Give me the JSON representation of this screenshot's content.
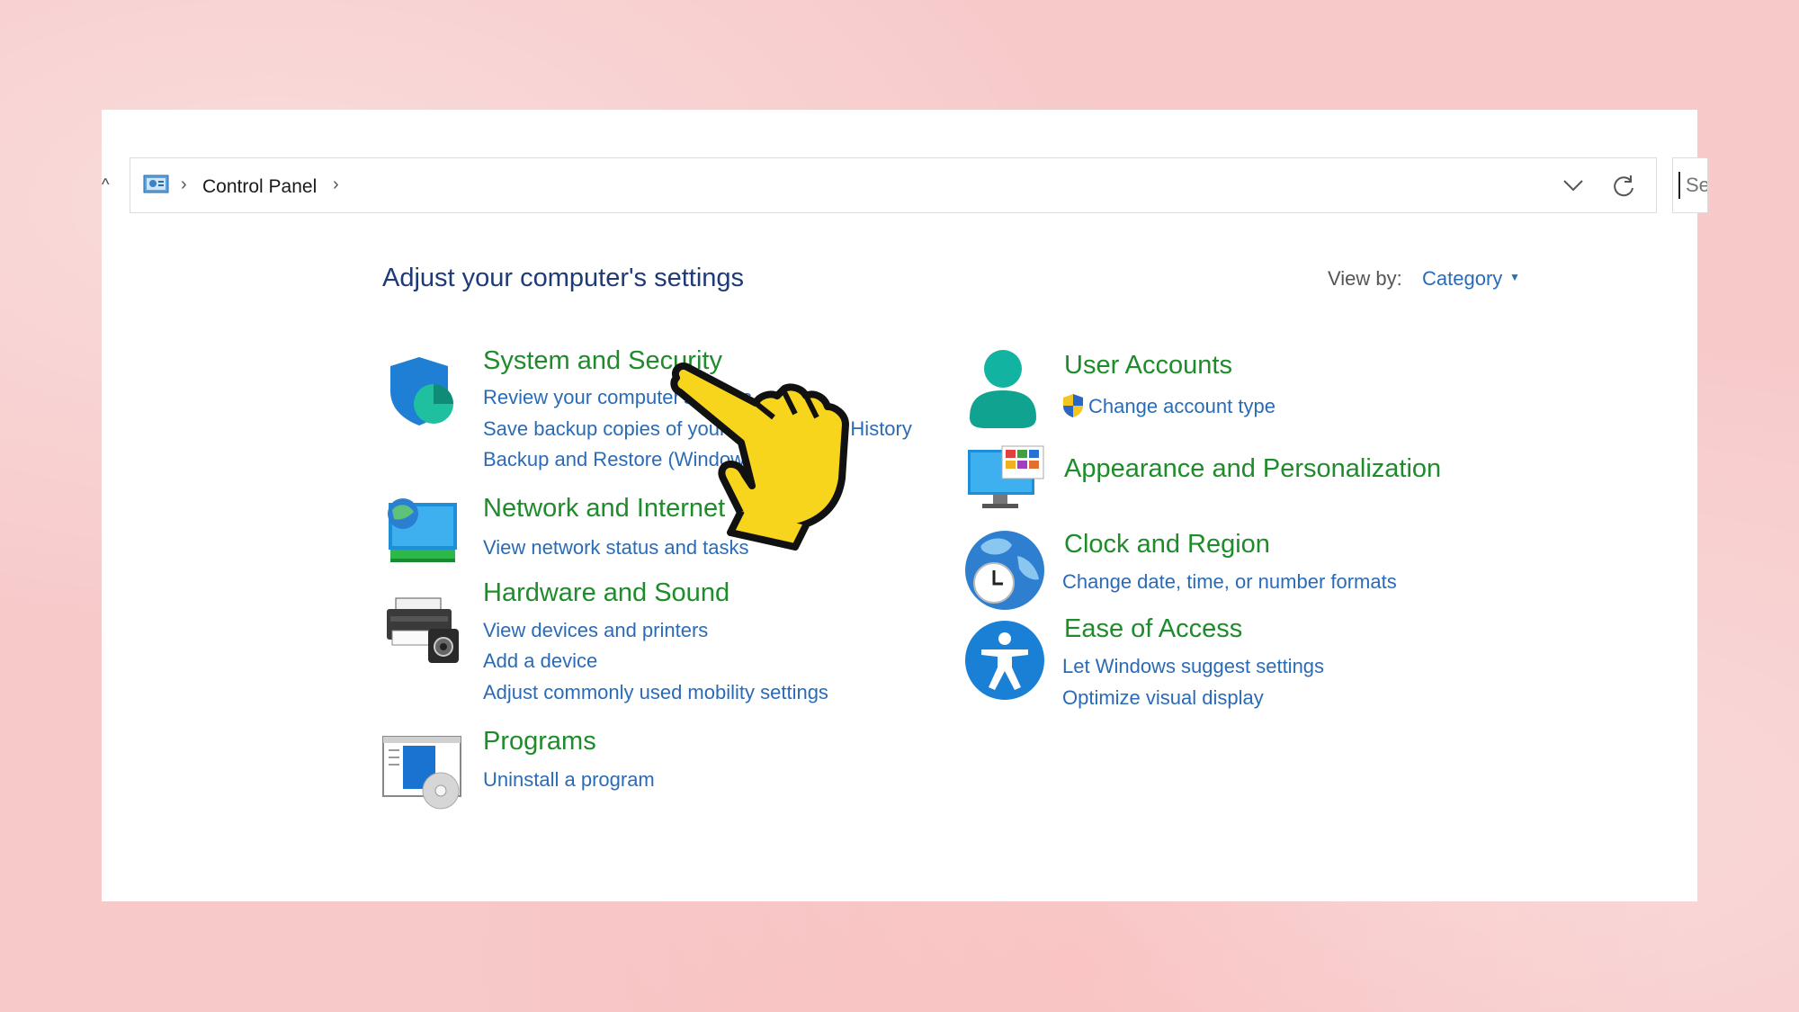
{
  "address_bar": {
    "breadcrumb": "Control Panel",
    "separator": "›"
  },
  "search": {
    "placeholder": "Se"
  },
  "header": {
    "title": "Adjust your computer's settings",
    "view_by_label": "View by:",
    "view_by_value": "Category"
  },
  "categories": [
    {
      "icon": "shield-icon",
      "title": "System and Security",
      "links": [
        "Review your computer's status",
        "Save backup copies of your files with File History",
        "Backup and Restore (Windows 7)"
      ]
    },
    {
      "icon": "network-monitor-icon",
      "title": "Network and Internet",
      "links": [
        "View network status and tasks"
      ]
    },
    {
      "icon": "printer-icon",
      "title": "Hardware and Sound",
      "links": [
        "View devices and printers",
        "Add a device",
        "Adjust commonly used mobility settings"
      ]
    },
    {
      "icon": "programs-icon",
      "title": "Programs",
      "links": [
        "Uninstall a program"
      ]
    },
    {
      "icon": "user-icon",
      "title": "User Accounts",
      "links": [
        "Change account type"
      ]
    },
    {
      "icon": "appearance-monitor-icon",
      "title": "Appearance and Personalization",
      "links": []
    },
    {
      "icon": "clock-globe-icon",
      "title": "Clock and Region",
      "links": [
        "Change date, time, or number formats"
      ]
    },
    {
      "icon": "accessibility-icon",
      "title": "Ease of Access",
      "links": [
        "Let Windows suggest settings",
        "Optimize visual display"
      ]
    }
  ],
  "colors": {
    "title_green": "#1e8c2a",
    "link_blue": "#2a6bb8",
    "heading_navy": "#1e3a78",
    "background_pink": "#f7c9c9"
  },
  "overlay": {
    "icon": "pointing-hand-icon"
  }
}
